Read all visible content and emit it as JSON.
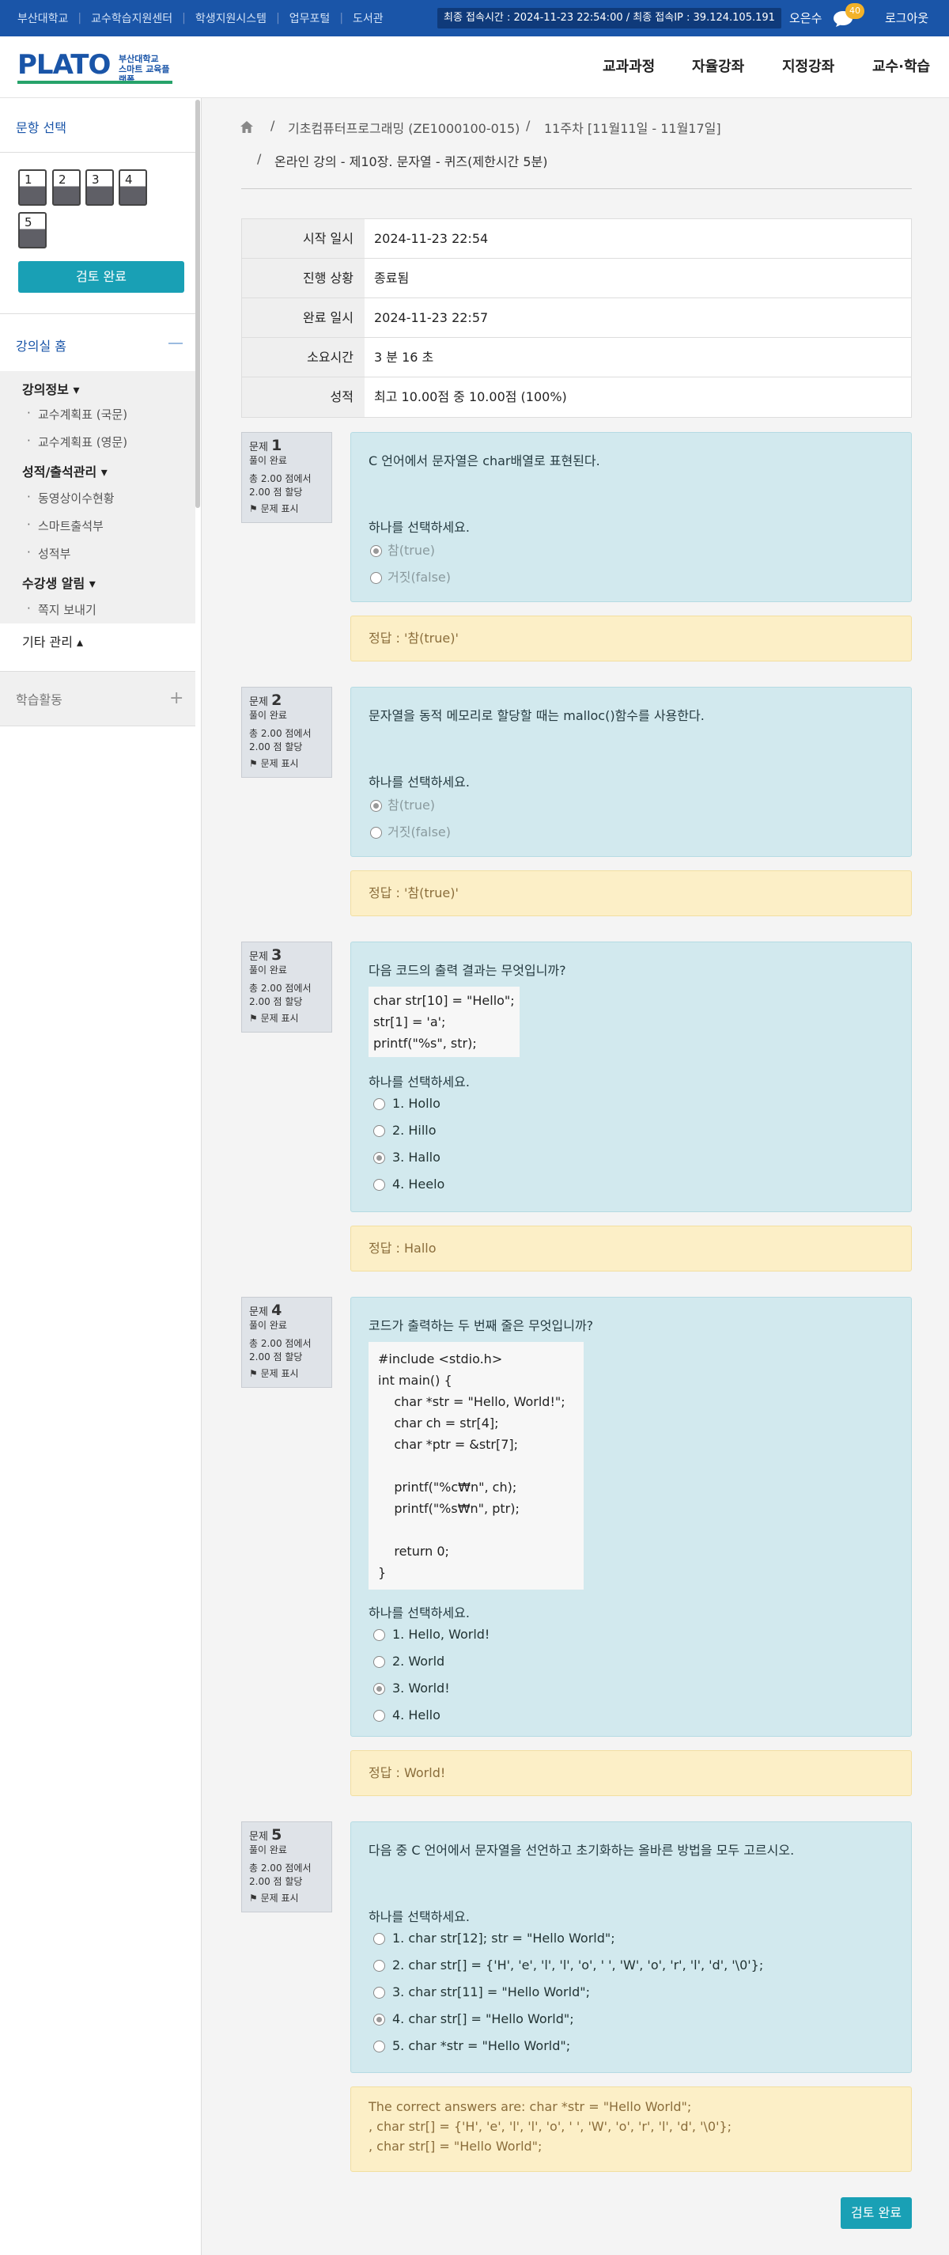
{
  "topbar": {
    "links": [
      "부산대학교",
      "교수학습지원센터",
      "학생지원시스템",
      "업무포털",
      "도서관"
    ],
    "access_info": "최종 접속시간 : 2024-11-23 22:54:00 / 최종 접속IP : 39.124.105.191",
    "user_name": "오은수",
    "notification_count": "40",
    "logout_label": "로그아웃"
  },
  "header": {
    "logo_text": "PLATO",
    "logo_sub_line1": "부산대학교",
    "logo_sub_line2": "스마트 교육플랫폼",
    "nav": [
      "교과과정",
      "자율강좌",
      "지정강좌",
      "교수·학습"
    ]
  },
  "sidebar": {
    "title": "문항 선택",
    "questions": [
      "1",
      "2",
      "3",
      "4",
      "5"
    ],
    "review_label": "검토 완료",
    "home_label": "강의실 홈",
    "groups": {
      "g1": "강의정보 ▾",
      "g1_items": [
        "교수계획표 (국문)",
        "교수계획표 (영문)"
      ],
      "g2": "성적/출석관리 ▾",
      "g2_items": [
        "동영상이수현황",
        "스마트출석부",
        "성적부"
      ],
      "g3": "수강생 알림 ▾",
      "g3_items": [
        "쪽지 보내기"
      ],
      "g4": "기타 관리 ▴"
    },
    "learning_label": "학습활동"
  },
  "breadcrumb": {
    "sep": "/",
    "course": "기초컴퓨터프로그래밍 (ZE1000100-015)",
    "week": "11주차 [11월11일 - 11월17일]",
    "quiz": "온라인 강의 - 제10장. 문자열 - 퀴즈(제한시간 5분)"
  },
  "summary": [
    {
      "label": "시작 일시",
      "value": "2024-11-23 22:54"
    },
    {
      "label": "진행 상황",
      "value": "종료됨"
    },
    {
      "label": "완료 일시",
      "value": "2024-11-23 22:57"
    },
    {
      "label": "소요시간",
      "value": "3 분 16 초"
    },
    {
      "label": "성적",
      "value": "최고 10.00점 중 10.00점 (100%)"
    }
  ],
  "qinfo_common": {
    "prefix": "문제",
    "status": "풀이 완료",
    "score_line1": "총 2.00 점에서",
    "score_line2": "2.00 점 할당",
    "flag": "문제 표시"
  },
  "prompt_label": "하나를 선택하세요.",
  "questions": [
    {
      "number": "1",
      "text": "C 언어에서 문자열은 char배열로 표현된다.",
      "options": [
        "참(true)",
        "거짓(false)"
      ],
      "answer": "정답 : '참(true)'"
    },
    {
      "number": "2",
      "text": "문자열을 동적 메모리로 할당할 때는 malloc()함수를 사용한다.",
      "options": [
        "참(true)",
        "거짓(false)"
      ],
      "answer": "정답 : '참(true)'"
    },
    {
      "number": "3",
      "text": "다음 코드의 출력 결과는 무엇입니까?",
      "code": "char str[10] = \"Hello\";\nstr[1] = 'a';\nprintf(\"%s\", str);",
      "options": [
        "1. Hollo",
        "2. Hillo",
        "3. Hallo",
        "4. Heelo"
      ],
      "answer": "정답 : Hallo"
    },
    {
      "number": "4",
      "text": "코드가 출력하는 두 번째 줄은 무엇입니까?",
      "code": "#include <stdio.h>\nint main() {\n    char *str = \"Hello, World!\";\n    char ch = str[4];\n    char *ptr = &str[7];\n\n    printf(\"%c₩n\", ch);\n    printf(\"%s₩n\", ptr);\n\n    return 0;\n}",
      "options": [
        "1. Hello, World!",
        "2. World",
        "3.  World!",
        "4. Hello"
      ],
      "answer": "정답 :  World!"
    },
    {
      "number": "5",
      "text": "다음 중 C 언어에서 문자열을 선언하고 초기화하는 올바른 방법을 모두 고르시오.",
      "options": [
        "1. char str[12]; str = \"Hello World\";",
        "2. char str[] = {'H', 'e', 'l', 'l', 'o', ' ', 'W', 'o', 'r', 'l', 'd', '\\0'};",
        "3. char str[11] = \"Hello World\";",
        "4. char str[] = \"Hello World\";",
        "5. char *str = \"Hello World\";"
      ],
      "answer_lines": [
        "The correct answers are:  char *str = \"Hello World\";",
        ", char str[] = {'H', 'e', 'l', 'l', 'o', ' ', 'W', 'o', 'r', 'l', 'd', '\\0'};",
        ", char str[] = \"Hello World\";"
      ]
    }
  ],
  "final_button": "검토 완료",
  "colors": {
    "primary": "#1a55a8",
    "teal": "#19a0b5",
    "question_bg": "#d2e9ee",
    "answer_bg": "#fcefc7"
  }
}
